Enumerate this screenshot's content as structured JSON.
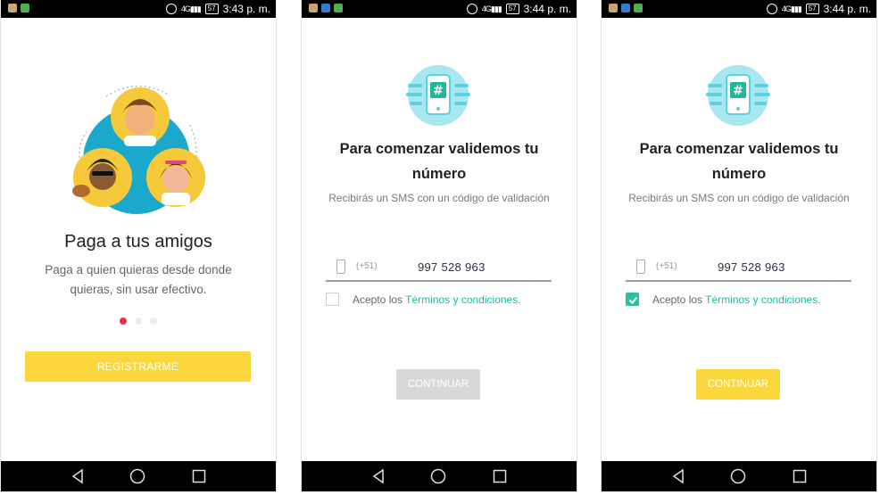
{
  "screens": [
    {
      "status": {
        "time": "3:43 p. m.",
        "network": "4G",
        "battery": "57"
      },
      "title": "Paga a tus amigos",
      "subtitle": "Paga a quien quieras desde donde quieras, sin usar efectivo.",
      "pager": {
        "count": 3,
        "active": 1
      },
      "register_button": "REGISTRARME"
    },
    {
      "status": {
        "time": "3:44 p. m.",
        "network": "4G",
        "battery": "57"
      },
      "title": "Para comenzar validemos tu número",
      "subtitle": "Recibirás un SMS con un código de validación",
      "phone": {
        "prefix": "(+51)",
        "number": "997 528 963"
      },
      "terms": {
        "text": "Acepto los ",
        "link": "Términos y condiciones.",
        "checked": false
      },
      "continue_button": "CONTINUAR",
      "continue_enabled": false
    },
    {
      "status": {
        "time": "3:44 p. m.",
        "network": "4G",
        "battery": "57"
      },
      "title": "Para comenzar validemos tu número",
      "subtitle": "Recibirás un SMS con un código de validación",
      "phone": {
        "prefix": "(+51)",
        "number": "997 528 963"
      },
      "terms": {
        "text": "Acepto los ",
        "link": "Términos y condiciones.",
        "checked": true
      },
      "continue_button": "CONTINUAR",
      "continue_enabled": true
    }
  ],
  "colors": {
    "accent_yellow": "#fcd73c",
    "accent_teal": "#22b7a4",
    "pager_active": "#e8334a",
    "disabled_gray": "#d8d8d8"
  },
  "icons": [
    "alarm-icon",
    "signal-icon",
    "battery-icon",
    "mobile-phone-icon",
    "hash-icon",
    "check-icon",
    "nav-back-icon",
    "nav-home-icon",
    "nav-recent-icon"
  ]
}
